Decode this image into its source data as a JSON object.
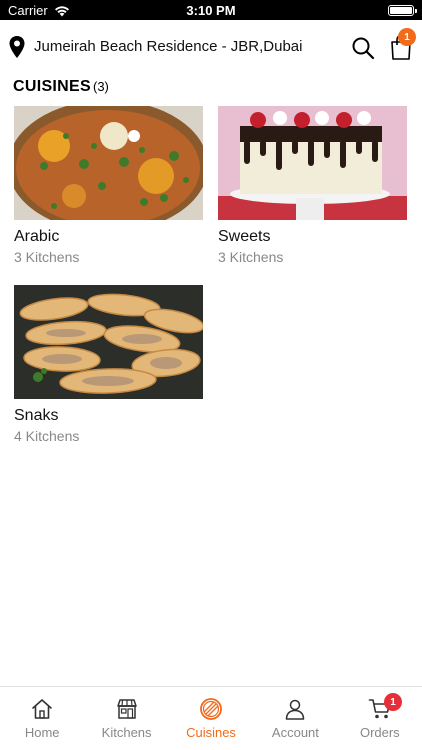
{
  "status_bar": {
    "carrier": "Carrier",
    "time": "3:10 PM"
  },
  "header": {
    "location": "Jumeirah Beach Residence - JBR,Dubai",
    "bag_badge": "1"
  },
  "section": {
    "title": "CUISINES",
    "count": "(3)"
  },
  "cuisines": [
    {
      "name": "Arabic",
      "kitchens": "3 Kitchens"
    },
    {
      "name": "Sweets",
      "kitchens": "3 Kitchens"
    },
    {
      "name": "Snaks",
      "kitchens": "4 Kitchens"
    }
  ],
  "tabs": [
    {
      "label": "Home"
    },
    {
      "label": "Kitchens"
    },
    {
      "label": "Cuisines"
    },
    {
      "label": "Account"
    },
    {
      "label": "Orders"
    }
  ],
  "active_tab": "Cuisines",
  "cart_badge": "1",
  "colors": {
    "accent": "#f26a1b",
    "badge_red": "#e5303b",
    "muted": "#888888"
  }
}
